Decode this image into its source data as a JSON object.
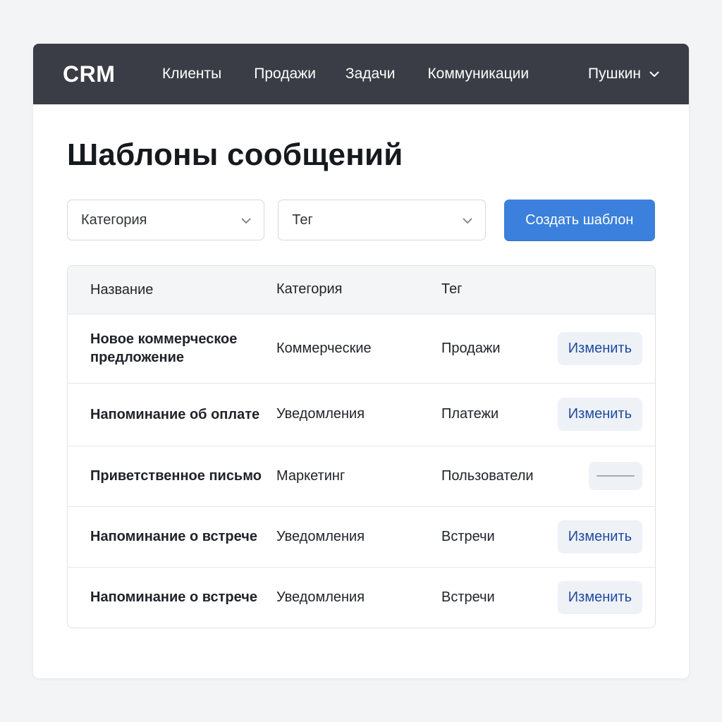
{
  "navbar": {
    "logo": "CRM",
    "links": [
      "Клиенты",
      "Продажи",
      "Задачи",
      "Коммуникации"
    ],
    "user": "Пушкин",
    "user_icon": "chevron-down-icon"
  },
  "page": {
    "title": "Шаблоны сообщений"
  },
  "filters": {
    "category_placeholder": "Категория",
    "tag_placeholder": "Тег",
    "create_label": "Создать шаблон"
  },
  "table": {
    "headers": [
      "Название",
      "Категория",
      "Тег"
    ],
    "rows": [
      {
        "name": "Новое коммерческое предложение",
        "category": "Коммерческие",
        "tag": "Продажи",
        "action": "Изменить"
      },
      {
        "name": "Напоминание об оплате",
        "category": "Уведомления",
        "tag": "Платежи",
        "action": "Изменить"
      },
      {
        "name": "Приветственное письмо",
        "category": "Маркетинг",
        "tag": "Пользователи",
        "action": ""
      },
      {
        "name": "Напоминание о встрече",
        "category": "Уведомления",
        "tag": "Встречи",
        "action": "Изменить"
      },
      {
        "name": "Напоминание о встрече",
        "category": "Уведомления",
        "tag": "Встречи",
        "action": "Изменить"
      }
    ]
  },
  "colors": {
    "navbar_bg": "#3a3d45",
    "primary": "#3b80dc",
    "edit_text": "#1f4aa0",
    "edit_bg": "#eef2f7"
  }
}
